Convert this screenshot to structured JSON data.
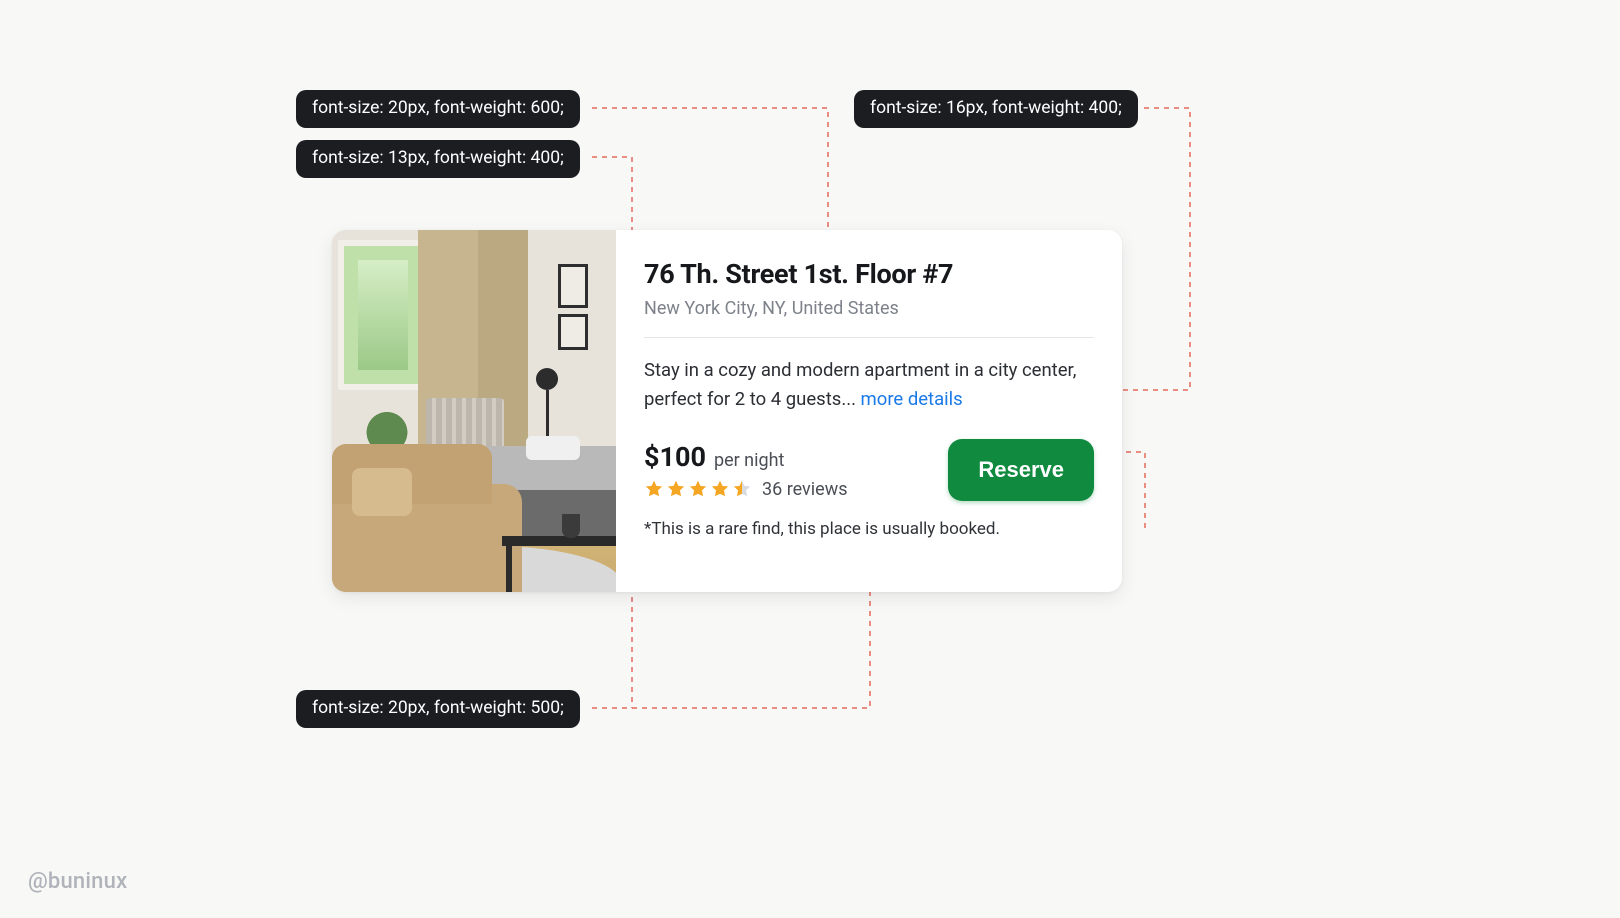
{
  "watermark": "@buninux",
  "annotations": {
    "title_spec": "font-size: 20px, font-weight: 600;",
    "subtext_spec": "font-size: 13px, font-weight: 400;",
    "body_spec": "font-size: 16px, font-weight: 400;",
    "price_spec": "font-size: 20px, font-weight: 500;"
  },
  "listing": {
    "title": "76 Th. Street 1st. Floor #7",
    "location": "New York City, NY, United States",
    "description": "Stay in a cozy and modern apartment in a city center, perfect for 2 to 4 guests... ",
    "more_label": "more details",
    "price": "$100",
    "price_suffix": "per night",
    "rating_stars": 4.5,
    "reviews_label": "36 reviews",
    "reserve_label": "Reserve",
    "footnote": "*This is a rare find, this place is usually booked."
  }
}
